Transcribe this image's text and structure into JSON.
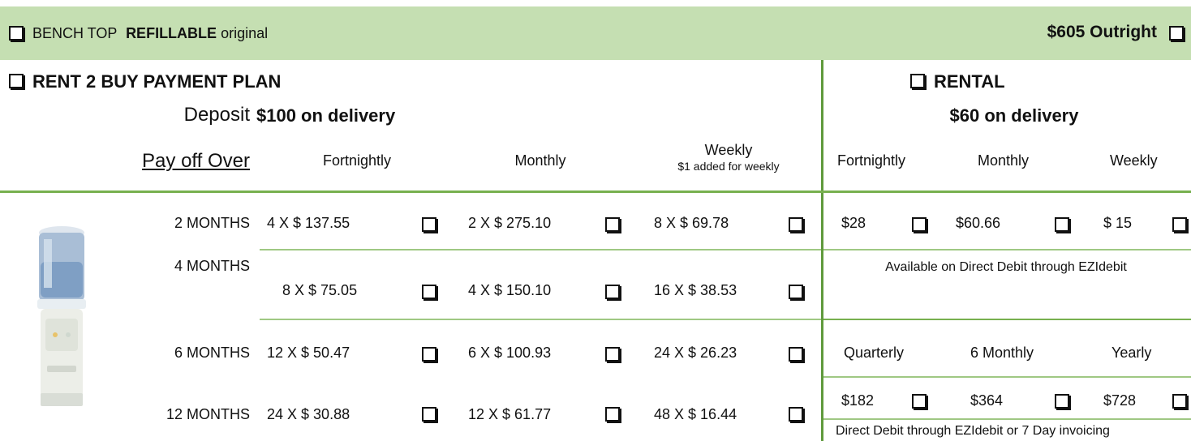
{
  "top_bar": {
    "product_prefix": "BENCH TOP",
    "product_bold": "REFILLABLE",
    "product_suffix": "original",
    "outright_price": "$605 Outright"
  },
  "rent2buy": {
    "title": "RENT 2 BUY PAYMENT PLAN",
    "deposit_label": "Deposit",
    "deposit_value": "$100 on delivery",
    "pay_off_label": "Pay off Over",
    "columns": {
      "fortnightly": "Fortnightly",
      "monthly": "Monthly",
      "weekly": "Weekly",
      "weekly_note": "$1 added for weekly"
    },
    "rows": [
      {
        "term": "2 MONTHS",
        "fortnightly": "4 X $ 137.55",
        "monthly": "2 X $ 275.10",
        "weekly": "8 X $ 69.78"
      },
      {
        "term": "4 MONTHS",
        "fortnightly": "8 X $ 75.05",
        "monthly": "4 X $ 150.10",
        "weekly": "16 X $ 38.53"
      },
      {
        "term": "6 MONTHS",
        "fortnightly": "12 X $ 50.47",
        "monthly": "6 X $ 100.93",
        "weekly": "24 X $ 26.23"
      },
      {
        "term": "12 MONTHS",
        "fortnightly": "24 X $ 30.88",
        "monthly": "12 X $ 61.77",
        "weekly": "48 X $ 16.44"
      }
    ]
  },
  "rental": {
    "title": "RENTAL",
    "deposit_value": "$60 on delivery",
    "columns": {
      "fortnightly": "Fortnightly",
      "monthly": "Monthly",
      "weekly": "Weekly"
    },
    "prices": {
      "fortnightly": "$28",
      "monthly": "$60.66",
      "weekly": "$ 15"
    },
    "direct_debit_note": "Available on Direct Debit through EZIdebit",
    "long_columns": {
      "quarterly": "Quarterly",
      "six_monthly": "6 Monthly",
      "yearly": "Yearly"
    },
    "long_prices": {
      "quarterly": "$182",
      "six_monthly": "$364",
      "yearly": "$728"
    },
    "invoicing_note": "Direct Debit through EZIdebit or 7 Day invoicing"
  }
}
